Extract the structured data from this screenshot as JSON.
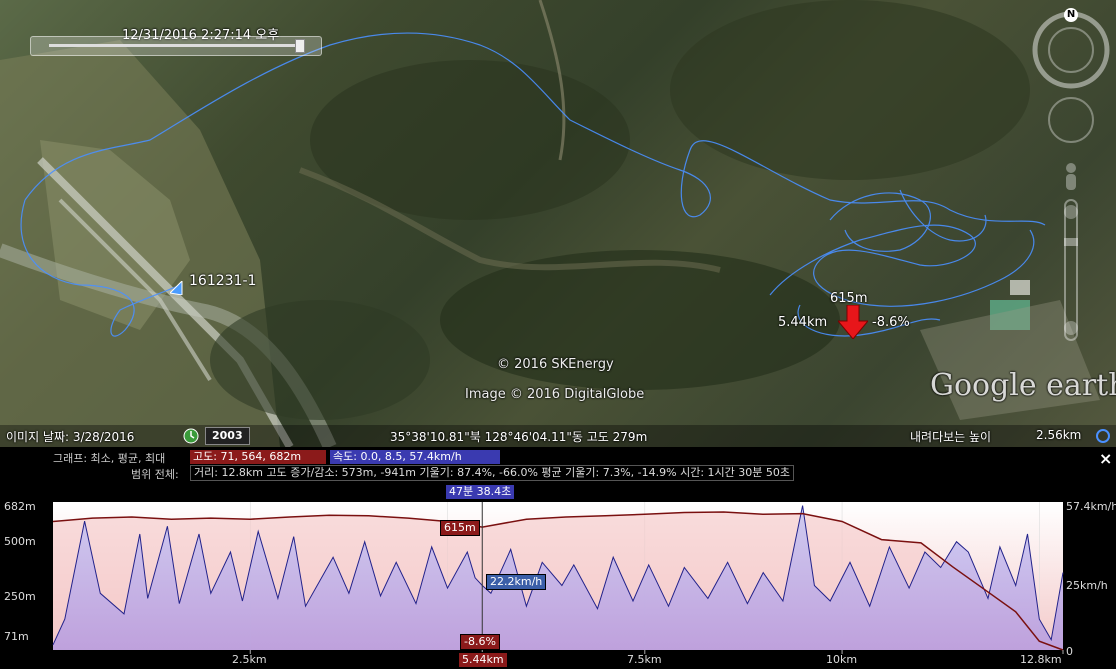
{
  "time_slider": {
    "label": "12/31/2016   2:27:14 오후"
  },
  "map": {
    "track_label": "161231-1",
    "marker": {
      "altitude": "615m",
      "distance": "5.44km",
      "grade": "-8.6%"
    },
    "copyright_1": "© 2016 SKEnergy",
    "copyright_2": "Image © 2016 DigitalGlobe",
    "logo": "Google earth",
    "compass_n": "N"
  },
  "status_bar": {
    "imagery_date": "이미지 날짜: 3/28/2016",
    "year": "2003",
    "coords": "35°38'10.81\"북 128°46'04.11\"동 고도   279m",
    "eye_alt_label": "내려다보는 높이",
    "eye_alt_value": "2.56km"
  },
  "profile": {
    "close_label": "×",
    "graph_label": "그래프: 최소, 평균, 최대",
    "altitude_box": "고도: 71, 564, 682m",
    "speed_box": "속도: 0.0, 8.5, 57.4km/h",
    "range_label": "범위 전체:",
    "stats": "거리: 12.8km 고도 증가/감소: 573m, -941m 기울기: 87.4%, -66.0% 평균 기울기: 7.3%, -14.9% 시간: 1시간 30분 50초",
    "cursor_time": "47분 38.4초",
    "cursor_alt": "615m",
    "cursor_speed": "22.2km/h",
    "cursor_grade": "-8.6%",
    "cursor_dist": "5.44km",
    "colors": {
      "altitude": "#8b1a1a",
      "speed": "#3a3ab0"
    }
  },
  "chart_data": {
    "type": "area",
    "title": "",
    "x_axis": {
      "unit": "km",
      "range": [
        0,
        12.8
      ],
      "ticks": [
        "2.5km",
        "5.44km",
        "7.5km",
        "10km",
        "12.8km"
      ]
    },
    "y_left": {
      "unit": "m",
      "range": [
        71,
        682
      ],
      "ticks": [
        "682m",
        "500m",
        "250m",
        "71m"
      ]
    },
    "y_right": {
      "unit": "km/h",
      "range": [
        0,
        57.4
      ],
      "ticks": [
        "57.4km/h",
        "25km/h",
        "0"
      ]
    },
    "series": [
      {
        "name": "고도",
        "x": [
          0,
          0.5,
          1,
          1.5,
          2,
          2.5,
          3,
          3.5,
          4,
          4.5,
          5,
          5.44,
          6,
          6.5,
          7,
          7.5,
          8,
          8.5,
          9,
          9.5,
          10,
          10.5,
          11,
          11.4,
          11.8,
          12.2,
          12.5,
          12.8
        ],
        "values": [
          640,
          655,
          660,
          650,
          655,
          650,
          660,
          668,
          665,
          655,
          640,
          615,
          650,
          660,
          665,
          672,
          680,
          682,
          672,
          675,
          640,
          560,
          545,
          440,
          340,
          240,
          110,
          71
        ]
      },
      {
        "name": "속도",
        "x": [
          0,
          0.15,
          0.4,
          0.6,
          0.9,
          1.1,
          1.2,
          1.45,
          1.6,
          1.85,
          2.0,
          2.25,
          2.4,
          2.6,
          2.85,
          3.05,
          3.2,
          3.55,
          3.75,
          3.95,
          4.15,
          4.35,
          4.6,
          4.8,
          5.0,
          5.25,
          5.35,
          5.44,
          5.55,
          5.8,
          6.0,
          6.2,
          6.45,
          6.6,
          6.9,
          7.1,
          7.35,
          7.55,
          7.8,
          8.0,
          8.3,
          8.55,
          8.8,
          9.0,
          9.25,
          9.5,
          9.65,
          9.85,
          10.1,
          10.35,
          10.6,
          10.85,
          11.05,
          11.25,
          11.45,
          11.6,
          11.85,
          12.0,
          12.2,
          12.35,
          12.5,
          12.65,
          12.8
        ],
        "values": [
          2,
          12,
          50,
          22,
          14,
          45,
          20,
          48,
          18,
          45,
          22,
          38,
          19,
          46,
          20,
          44,
          17,
          36,
          22,
          42,
          21,
          34,
          18,
          40,
          24,
          38,
          28,
          25,
          22,
          39,
          17,
          34,
          25,
          33,
          16,
          36,
          19,
          33,
          17,
          32,
          20,
          34,
          18,
          30,
          19,
          56,
          25,
          19,
          34,
          17,
          40,
          24,
          38,
          32,
          42,
          38,
          20,
          40,
          25,
          45,
          12,
          4,
          30
        ]
      }
    ]
  }
}
